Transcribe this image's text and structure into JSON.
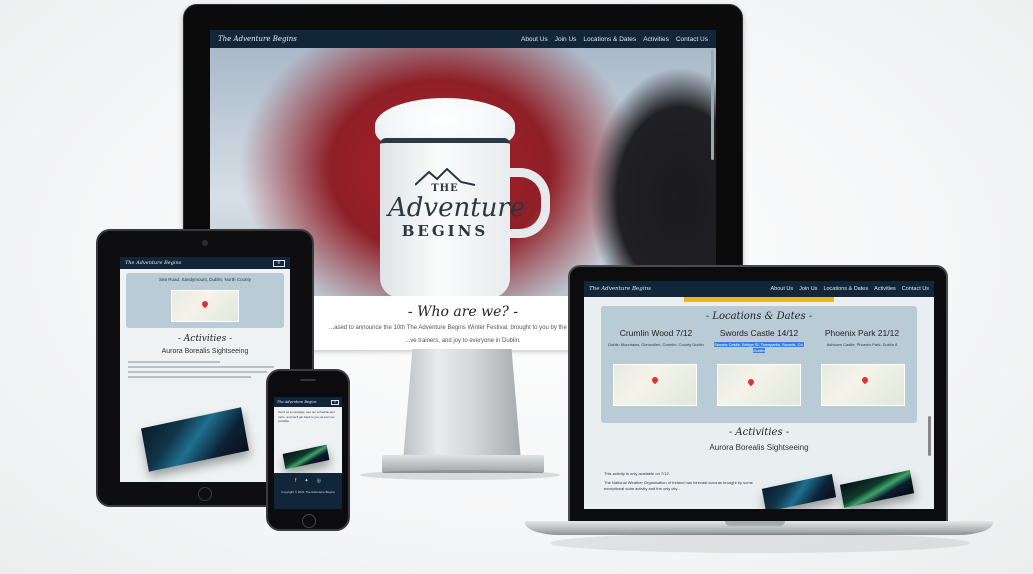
{
  "desktop": {
    "brand": "The Adventure Begins",
    "nav": [
      "About Us",
      "Join Us",
      "Locations & Dates",
      "Activities",
      "Contact Us"
    ],
    "mug": {
      "line1": "THE",
      "line2": "Adventure",
      "line3": "BEGINS"
    },
    "about_heading": "- Who are we? -",
    "about_text": "...ased to announce the 10th The Adventure Begins Winter Festival, brought to you by the expert fo...",
    "about_text2": "...ve trainers, and joy to everyone in Dublin."
  },
  "tablet": {
    "brand": "The Adventure Begins",
    "menu_icon": "hamburger-icon",
    "card_text": "Sea Road, Sandymount, Dublin, North County",
    "activities_heading": "- Activities -",
    "activity_name": "Aurora Borealis Sightseeing"
  },
  "phone": {
    "brand": "The Adventure Begins",
    "menu_icon": "hamburger-icon",
    "text": "Send us a message, see our schedule and more, and we'll get back to you as soon as possible",
    "social_icons": [
      "facebook-icon",
      "twitter-icon",
      "instagram-icon"
    ],
    "copyright": "Copyright © 2021 The Adventure Begins"
  },
  "laptop": {
    "brand": "The Adventure Begins",
    "nav": [
      "About Us",
      "Join Us",
      "Locations & Dates",
      "Activities",
      "Contact Us"
    ],
    "locations_heading": "- Locations & Dates -",
    "locations": [
      {
        "name": "Crumlin Wood 7/12",
        "address": "Dublin Mountains, Glencullen, Crumlin, County Dublin",
        "highlight": false
      },
      {
        "name": "Swords Castle 14/12",
        "address": "Swords Castle, Bridge St, Townparks, Swords, Co. Dublin",
        "highlight": true
      },
      {
        "name": "Phoenix Park 21/12",
        "address": "Ashtown Castle, Phoenix Park, Dublin 8",
        "highlight": false
      }
    ],
    "activities_heading": "- Activities -",
    "activity_name": "Aurora Borealis Sightseeing",
    "activity_text1": "This activity is only available on 7/12.",
    "activity_text2": "The National Weather Organisation of Ireland has forecast auroras brought by some exceptional solar activity and the only city..."
  },
  "colors": {
    "navbar": "#12263a",
    "panel": "#b9ccd6",
    "accent_yellow": "#f0b51e",
    "highlight": "#3d7fe0"
  }
}
